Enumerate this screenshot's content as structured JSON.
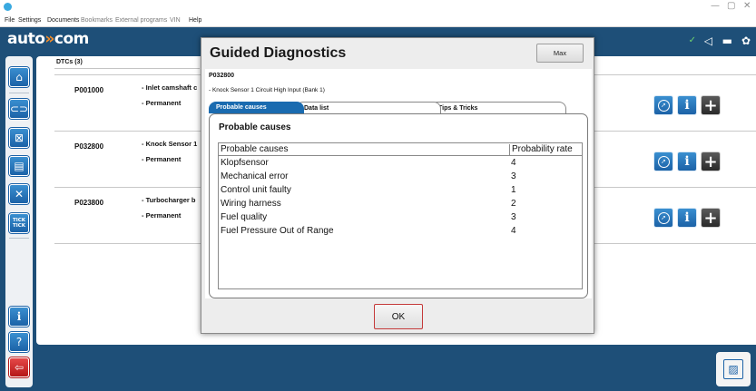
{
  "window": {
    "controls": [
      "—",
      "▢",
      "✕"
    ]
  },
  "menu": {
    "items": [
      {
        "label": "File",
        "enabled": true
      },
      {
        "label": "Settings",
        "enabled": true
      },
      {
        "label": "Documents",
        "enabled": true
      },
      {
        "label": "Bookmarks",
        "enabled": false
      },
      {
        "label": "External programs",
        "enabled": false
      },
      {
        "label": "VIN",
        "enabled": false
      },
      {
        "label": "Help",
        "enabled": true
      }
    ]
  },
  "header": {
    "logo_left": "auto",
    "logo_mid": "»",
    "logo_right": "com",
    "icons": [
      "check-icon",
      "megaphone-icon",
      "battery-icon",
      "settings-gear-icon"
    ]
  },
  "sidebar": {
    "top_items": [
      "home-icon",
      "vehicle-connect-icon",
      "component-icon",
      "report-icon",
      "tools-icon",
      "tick-tick-icon"
    ],
    "tick_label": "TICK TICK",
    "bottom_items": [
      "info-icon",
      "help-icon",
      "back-arrow-icon"
    ]
  },
  "dtc_list": {
    "tab_label": "DTCs (3)",
    "rows": [
      {
        "code": "P001000",
        "desc": "- Inlet camshaft c",
        "status": "- Permanent"
      },
      {
        "code": "P032800",
        "desc": "- Knock Sensor 1",
        "status": "- Permanent"
      },
      {
        "code": "P023800",
        "desc": "- Turbocharger b",
        "status": "- Permanent"
      }
    ]
  },
  "modal": {
    "title": "Guided Diagnostics",
    "max_label": "Max",
    "code": "P032800",
    "description": "- Knock Sensor 1 Circuit High Input (Bank 1)",
    "tabs": [
      "Probable causes",
      "Data list",
      "Tips & Tricks"
    ],
    "active_tab": "Probable causes",
    "section_title": "Probable causes",
    "table": {
      "headers": [
        "Probable causes",
        "Probability rate"
      ],
      "rows": [
        [
          "Klopfsensor",
          "4"
        ],
        [
          "Mechanical error",
          "3"
        ],
        [
          "Control unit faulty",
          "1"
        ],
        [
          "Wiring harness",
          "2"
        ],
        [
          "Fuel quality",
          "3"
        ],
        [
          "Fuel Pressure Out of Range",
          "4"
        ]
      ]
    },
    "ok_label": "OK"
  },
  "colors": {
    "background": "#1e4f78",
    "accent_blue": "#1a6bb0",
    "alert_red": "#c53a3a",
    "logo_accent": "#f28c28"
  }
}
